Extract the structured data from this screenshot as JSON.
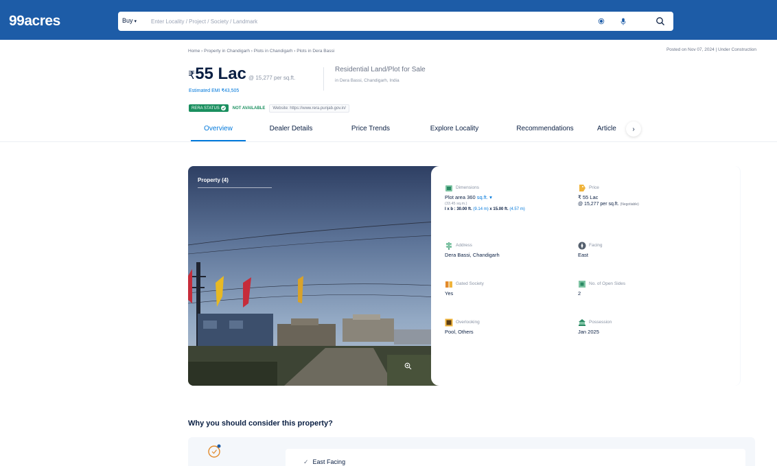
{
  "header": {
    "logo": "99acres",
    "buy_label": "Buy",
    "search_placeholder": "Enter Locality / Project / Society / Landmark"
  },
  "breadcrumb": "Home › Property in Chandigarh › Plots in Chandigarh › Plots in Dera Bassi",
  "posted": "Posted on Nov 07, 2024  |  Under Construction",
  "listing": {
    "currency": "₹",
    "price": "55 Lac",
    "price_per_sqft": "@ 15,277 per sq.ft.",
    "emi": "Estimated EMI ₹43,505",
    "title": "Residential Land/Plot for Sale",
    "address": "in Dera Bassi, Chandigarh, India"
  },
  "rera": {
    "badge": "RERA STATUS",
    "status": "NOT AVAILABLE",
    "website": "Website: https://www.rera.punjab.gov.in/"
  },
  "tabs": [
    "Overview",
    "Dealer Details",
    "Price Trends",
    "Explore Locality",
    "Recommendations",
    "Article"
  ],
  "photo": {
    "label": "Property (4)"
  },
  "details": {
    "dimensions": {
      "label": "Dimensions",
      "value": "Plot area 360",
      "unit": "sq.ft.",
      "sub": "(33.45 sq.m.)",
      "lxb_value": "l x b : 30.00 ft.",
      "lxb_m1": "(9.14 m)",
      "lxb_x": "x 15.00 ft.",
      "lxb_m2": "(4.57 m)"
    },
    "price": {
      "label": "Price",
      "value": "₹ 55 Lac",
      "sub": "@ 15,277 per sq.ft.",
      "neg": "(Negotiable)"
    },
    "address": {
      "label": "Address",
      "value": "Dera Bassi, Chandigarh"
    },
    "facing": {
      "label": "Facing",
      "value": "East"
    },
    "gated": {
      "label": "Gated Society",
      "value": "Yes"
    },
    "open_sides": {
      "label": "No. of Open Sides",
      "value": "2"
    },
    "overlooking": {
      "label": "Overlooking",
      "value": "Pool, Others"
    },
    "possession": {
      "label": "Possession",
      "value": "Jan 2025"
    }
  },
  "why": {
    "title": "Why you should consider this property?",
    "items": [
      "East Facing"
    ]
  },
  "colors": {
    "brand": "#1d5ca7",
    "link": "#0078db",
    "rera_green": "#1a8f5f"
  }
}
